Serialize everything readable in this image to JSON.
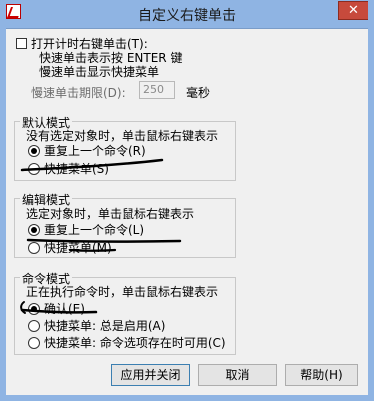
{
  "window": {
    "title": "自定义右键单击",
    "close_glyph": "✕",
    "app_icon": "autocad-icon"
  },
  "timing": {
    "checkbox_label": "打开计时右键单击(T):",
    "checkbox_checked": false,
    "line1": "快速单击表示按 ENTER 键",
    "line2": "慢速单击显示快捷菜单",
    "duration_label": "慢速单击期限(D):",
    "duration_value": "250",
    "unit": "毫秒"
  },
  "default_mode": {
    "title": "默认模式",
    "desc": "没有选定对象时，单击鼠标右键表示",
    "options": [
      "重复上一个命令(R)",
      "快捷菜单(S)"
    ],
    "selected": 0
  },
  "edit_mode": {
    "title": "编辑模式",
    "desc": "选定对象时，单击鼠标右键表示",
    "options": [
      "重复上一个命令(L)",
      "快捷菜单(M)"
    ],
    "selected": 0
  },
  "command_mode": {
    "title": "命令模式",
    "desc": "正在执行命令时，单击鼠标右键表示",
    "options": [
      "确认(E)",
      "快捷菜单: 总是启用(A)",
      "快捷菜单: 命令选项存在时可用(C)"
    ],
    "selected": 0
  },
  "buttons": {
    "apply_close": "应用并关闭",
    "cancel": "取消",
    "help": "帮助(H)"
  }
}
